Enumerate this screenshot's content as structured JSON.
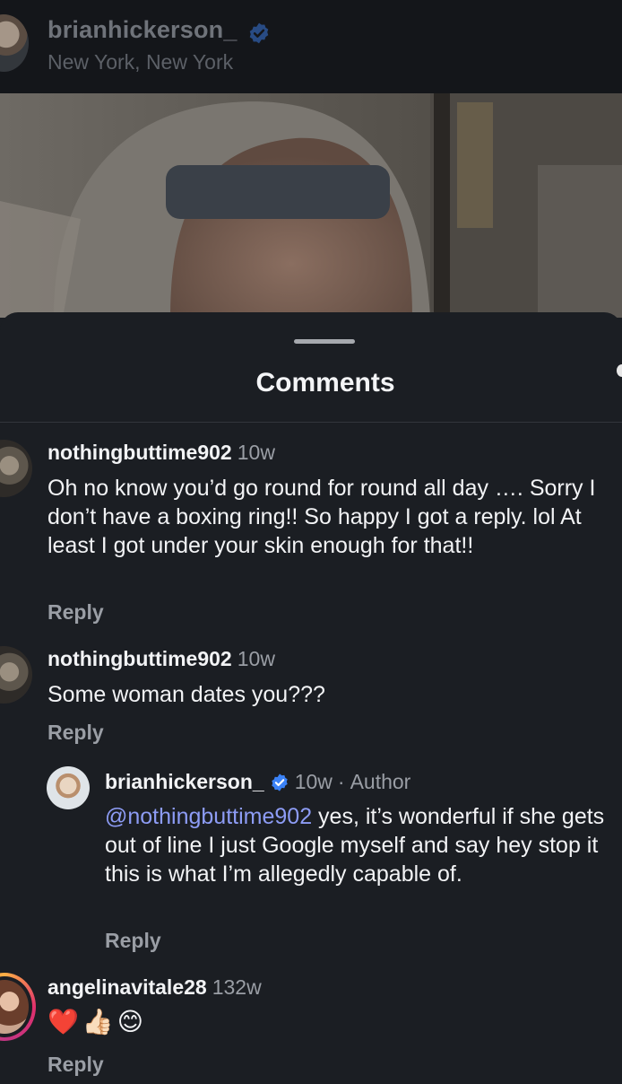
{
  "post_header": {
    "username": "brianhickerson_",
    "location": "New York, New York"
  },
  "sheet": {
    "title": "Comments"
  },
  "comments": [
    {
      "username": "nothingbuttime902",
      "time": "10w",
      "text": "Oh no know you’d go round for round all day …. Sorry I don’t have a boxing ring!! So happy I got a reply. lol At least I got under your skin enough for that!!",
      "reply_label": "Reply"
    },
    {
      "username": "nothingbuttime902",
      "time": "10w",
      "text": "Some woman dates you???",
      "reply_label": "Reply"
    },
    {
      "username": "brianhickerson_",
      "time": "10w",
      "author_label": "Author",
      "mention": "@nothingbuttime902",
      "text": " yes, it’s wonderful if she gets out of line I just Google myself and say hey stop it this is what I’m allegedly capable of.",
      "reply_label": "Reply"
    },
    {
      "username": "angelinavitale28",
      "time": "132w",
      "emojis": "❤️👍🏻😊",
      "reply_label": "Reply"
    }
  ],
  "colors": {
    "verified": "#3b82f6",
    "mention": "#8d9cf5",
    "story_ring": "#e1306c"
  },
  "icons": [
    "verified-badge-icon"
  ]
}
